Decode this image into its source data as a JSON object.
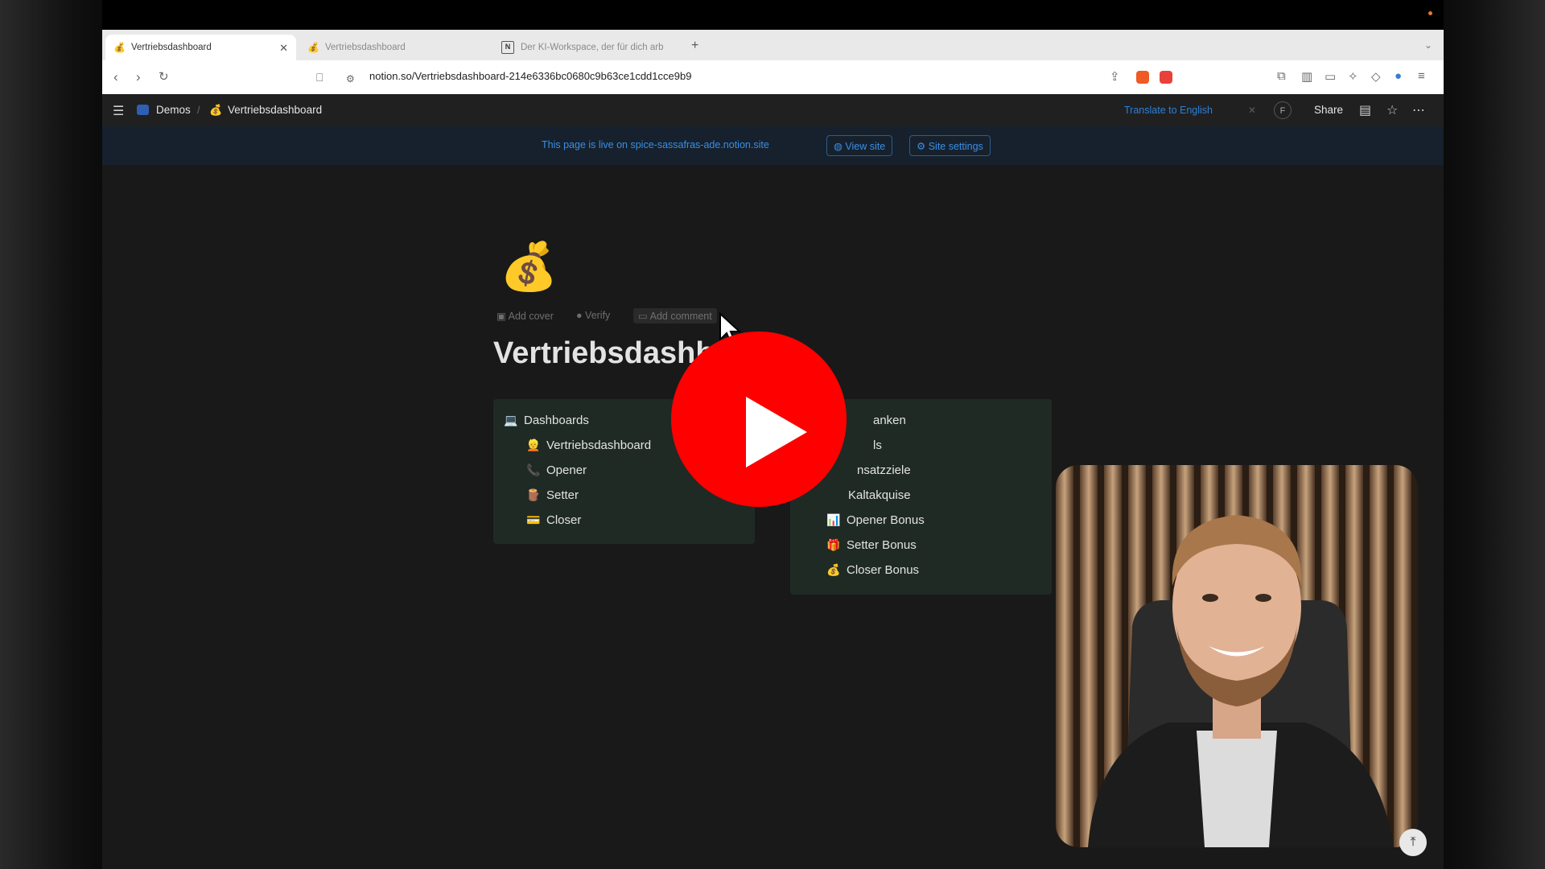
{
  "browser": {
    "tabs": [
      {
        "label": "Vertriebsdashboard",
        "favicon": "money-bag-icon",
        "active": true
      },
      {
        "label": "Vertriebsdashboard",
        "favicon": "money-bag-icon",
        "active": false
      },
      {
        "label": "Der KI-Workspace, der für dich arb",
        "favicon": "notion-icon",
        "active": false
      }
    ],
    "url": "notion.so/Vertriebsdashboard-214e6336bc0680c9b63ce1cdd1cce9b9"
  },
  "notion": {
    "breadcrumb": [
      "Demos",
      "Vertriebsdashboard"
    ],
    "translate_label": "Translate to English",
    "avatar_initial": "F",
    "share_label": "Share",
    "live_banner": {
      "text": "This page is live on spice-sassafras-ade.notion.site",
      "view_site": "View site",
      "site_settings": "Site settings"
    },
    "page": {
      "emoji": "💰",
      "actions": {
        "add_cover": "Add cover",
        "verify": "Verify",
        "add_comment": "Add comment"
      },
      "title": "Vertriebsdashb"
    },
    "left_panel": {
      "header": "Dashboards",
      "items": [
        {
          "icon": "👱",
          "label": "Vertriebsdashboard"
        },
        {
          "icon": "📞",
          "label": "Opener"
        },
        {
          "icon": "🪵",
          "label": "Setter"
        },
        {
          "icon": "💳",
          "label": "Closer"
        }
      ]
    },
    "right_panel": {
      "header": "anken",
      "items": [
        {
          "icon": "",
          "label": "ls"
        },
        {
          "icon": "",
          "label": "nsatzziele"
        },
        {
          "icon": "",
          "label": "Kaltakquise"
        },
        {
          "icon": "📊",
          "label": "Opener Bonus"
        },
        {
          "icon": "🎁",
          "label": "Setter Bonus"
        },
        {
          "icon": "💰",
          "label": "Closer Bonus"
        }
      ]
    }
  },
  "colors": {
    "play_button": "#ff0000",
    "notion_blue": "#2b81d8",
    "panel_bg": "#1f2a25"
  }
}
